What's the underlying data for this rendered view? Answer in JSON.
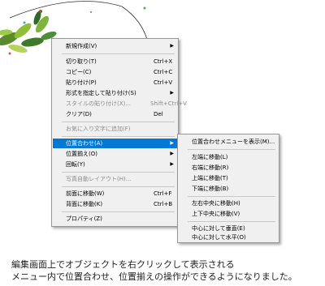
{
  "main_menu": {
    "items": [
      {
        "label": "新規作成(V)",
        "shortcut": "",
        "submenu": true,
        "disabled": false
      },
      {
        "label": "切り取り(T)",
        "shortcut": "Ctrl+X",
        "submenu": false,
        "disabled": false
      },
      {
        "label": "コピー(C)",
        "shortcut": "Ctrl+C",
        "submenu": false,
        "disabled": false
      },
      {
        "label": "貼り付け(P)",
        "shortcut": "Ctrl+V",
        "submenu": false,
        "disabled": false
      },
      {
        "label": "形式を指定して貼り付け(S)",
        "shortcut": "",
        "submenu": true,
        "disabled": false
      },
      {
        "label": "スタイルの貼り付け(X)...",
        "shortcut": "Shift+Ctrl+V",
        "submenu": false,
        "disabled": true
      },
      {
        "label": "クリア(D)",
        "shortcut": "Del",
        "submenu": false,
        "disabled": false
      },
      {
        "label": "お気に入り文字に追加(F)",
        "shortcut": "",
        "submenu": false,
        "disabled": true
      },
      {
        "label": "位置合わせ(A)",
        "shortcut": "",
        "submenu": true,
        "disabled": false,
        "highlighted": true
      },
      {
        "label": "位置揃え(O)",
        "shortcut": "",
        "submenu": true,
        "disabled": false
      },
      {
        "label": "回転(Y)",
        "shortcut": "",
        "submenu": true,
        "disabled": false
      },
      {
        "label": "写真自動レイアウト(H)...",
        "shortcut": "",
        "submenu": false,
        "disabled": true
      },
      {
        "label": "前面に移動(W)",
        "shortcut": "Ctrl+F",
        "submenu": false,
        "disabled": false
      },
      {
        "label": "背面に移動(K)",
        "shortcut": "Ctrl+B",
        "submenu": false,
        "disabled": false
      },
      {
        "label": "プロパティ(Z)",
        "shortcut": "",
        "submenu": false,
        "disabled": false
      }
    ]
  },
  "sub_menu": {
    "items": [
      {
        "label": "位置合わせメニューを表示(M)..."
      },
      {
        "label": "左端に移動(L)"
      },
      {
        "label": "右端に移動(R)"
      },
      {
        "label": "上端に移動(T)"
      },
      {
        "label": "下端に移動(B)"
      },
      {
        "label": "左右中央に移動(H)"
      },
      {
        "label": "上下中央に移動(V)"
      },
      {
        "label": "中心に対して垂直(E)"
      },
      {
        "label": "中心に対して水平(O)"
      }
    ]
  },
  "submenu_arrow": "▶",
  "caption": {
    "line1": "編集画面上でオブジェクトを右クリックして表示される",
    "line2": "メニュー内で位置合わせ、位置揃えの操作ができるようになりました。"
  },
  "colors": {
    "highlight": "#0078d7",
    "menu_bg": "#f0f0f0",
    "disabled_text": "#8c8c8c"
  }
}
